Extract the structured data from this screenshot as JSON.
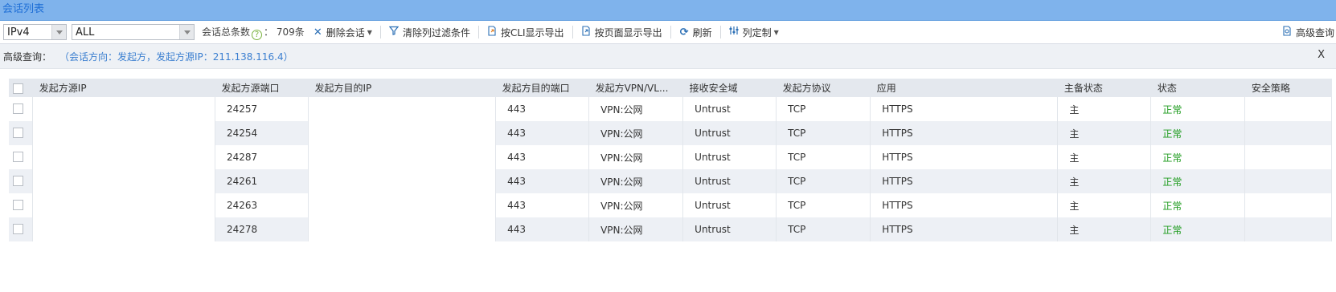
{
  "title": "会话列表",
  "toolbar": {
    "ip_version": "IPv4",
    "filter_all": "ALL",
    "total_label": "会话总条数",
    "total_suffix": "：",
    "total_count": "709条",
    "delete_label": "删除会话",
    "clear_filter_label": "清除列过滤条件",
    "export_cli_label": "按CLI显示导出",
    "export_page_label": "按页面显示导出",
    "refresh_label": "刷新",
    "customize_label": "列定制",
    "advanced_label": "高级查询"
  },
  "query": {
    "label": "高级查询：",
    "value": "（会话方向：发起方，发起方源IP：211.138.116.4）",
    "close": "X"
  },
  "table": {
    "headers": [
      "发起方源IP",
      "发起方源端口",
      "发起方目的IP",
      "发起方目的端口",
      "发起方VPN/VL...",
      "接收安全域",
      "发起方协议",
      "应用",
      "主备状态",
      "状态",
      "安全策略"
    ],
    "rows": [
      {
        "src_ip": "",
        "src_port": "24257",
        "dst_ip": "",
        "dst_port": "443",
        "vpn": "VPN:公网",
        "zone": "Untrust",
        "proto": "TCP",
        "app": "HTTPS",
        "ha": "主",
        "status": "正常",
        "policy": ""
      },
      {
        "src_ip": "",
        "src_port": "24254",
        "dst_ip": "",
        "dst_port": "443",
        "vpn": "VPN:公网",
        "zone": "Untrust",
        "proto": "TCP",
        "app": "HTTPS",
        "ha": "主",
        "status": "正常",
        "policy": ""
      },
      {
        "src_ip": "",
        "src_port": "24287",
        "dst_ip": "",
        "dst_port": "443",
        "vpn": "VPN:公网",
        "zone": "Untrust",
        "proto": "TCP",
        "app": "HTTPS",
        "ha": "主",
        "status": "正常",
        "policy": ""
      },
      {
        "src_ip": "",
        "src_port": "24261",
        "dst_ip": "",
        "dst_port": "443",
        "vpn": "VPN:公网",
        "zone": "Untrust",
        "proto": "TCP",
        "app": "HTTPS",
        "ha": "主",
        "status": "正常",
        "policy": ""
      },
      {
        "src_ip": "",
        "src_port": "24263",
        "dst_ip": "",
        "dst_port": "443",
        "vpn": "VPN:公网",
        "zone": "Untrust",
        "proto": "TCP",
        "app": "HTTPS",
        "ha": "主",
        "status": "正常",
        "policy": ""
      },
      {
        "src_ip": "",
        "src_port": "24278",
        "dst_ip": "",
        "dst_port": "443",
        "vpn": "VPN:公网",
        "zone": "Untrust",
        "proto": "TCP",
        "app": "HTTPS",
        "ha": "主",
        "status": "正常",
        "policy": ""
      }
    ]
  },
  "colors": {
    "titlebar_bg": "#7fb3ec",
    "title_text": "#1f6fd6",
    "status_ok": "#1e9b1e",
    "query_text": "#3b7fd0"
  },
  "icons": {
    "delete": "close-x-icon",
    "clear_filter": "filter-icon",
    "export_cli": "export-cli-icon",
    "export_page": "export-page-icon",
    "refresh": "refresh-icon",
    "customize": "columns-icon",
    "advanced": "advanced-query-icon",
    "help": "help-icon"
  }
}
